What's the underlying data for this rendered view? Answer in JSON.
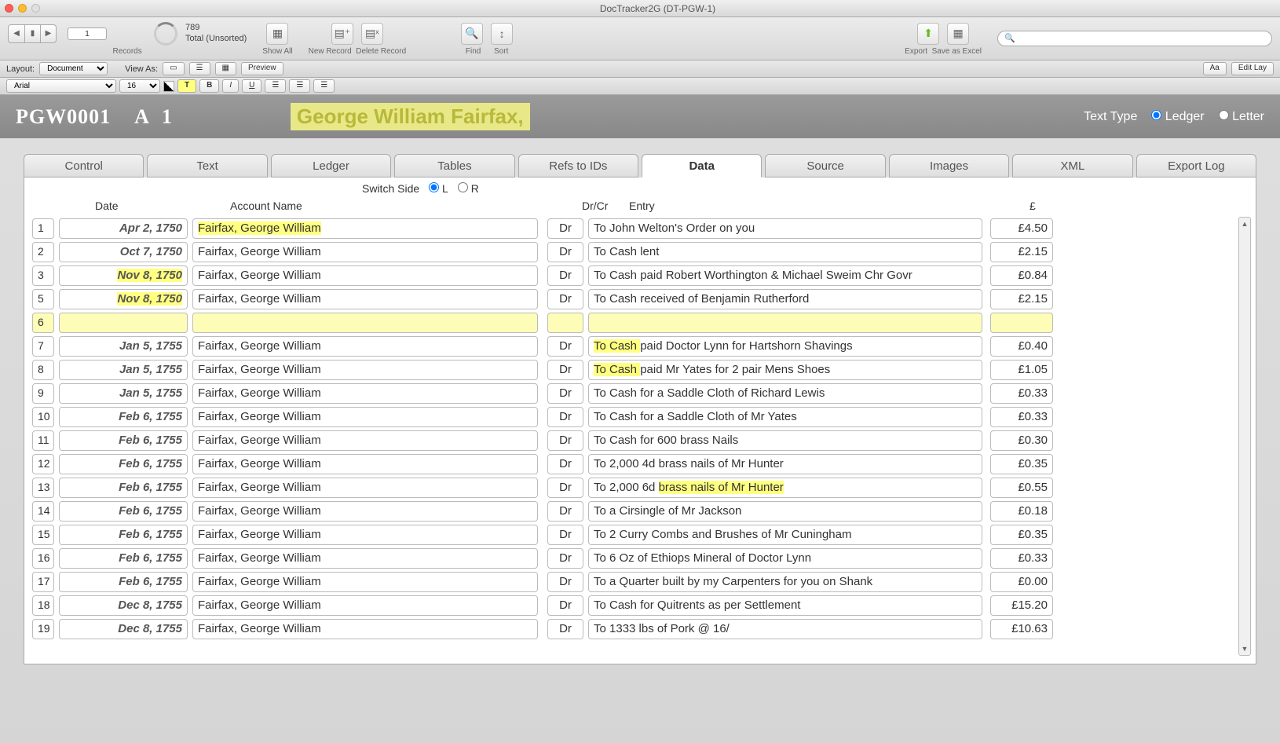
{
  "window_title": "DocTracker2G (DT-PGW-1)",
  "toolbar": {
    "record_number": "1",
    "total": "789",
    "sorted": "Total (Unsorted)",
    "records_label": "Records",
    "show_all": "Show All",
    "new_record": "New Record",
    "delete_record": "Delete Record",
    "find": "Find",
    "sort": "Sort",
    "export": "Export",
    "save_excel": "Save as Excel"
  },
  "layoutbar": {
    "layout_label": "Layout:",
    "layout_value": "Document",
    "viewas_label": "View As:",
    "preview": "Preview",
    "aa": "Aa",
    "editlay": "Edit Lay"
  },
  "formatbar": {
    "font": "Arial",
    "size": "16 pt"
  },
  "header": {
    "docid": "PGW0001",
    "side": "A",
    "page": "1",
    "person": "George William Fairfax,",
    "texttype": "Text Type",
    "ledger": "Ledger",
    "letter": "Letter"
  },
  "tabs": [
    "Control",
    "Text",
    "Ledger",
    "Tables",
    "Refs to IDs",
    "Data",
    "Source",
    "Images",
    "XML",
    "Export Log"
  ],
  "active_tab": "Data",
  "switch": {
    "label": "Switch Side",
    "L": "L",
    "R": "R"
  },
  "cols": {
    "date": "Date",
    "account": "Account Name",
    "drcr": "Dr/Cr",
    "entry": "Entry",
    "amt": "£"
  },
  "rows": [
    {
      "n": "1",
      "date": "Apr 2, 1750",
      "name": "Fairfax, George William",
      "drcr": "Dr",
      "entry": "To John Welton's Order on you",
      "amt": "£4.50",
      "name_hl": true
    },
    {
      "n": "2",
      "date": "Oct 7, 1750",
      "name": "Fairfax, George William",
      "drcr": "Dr",
      "entry": "To Cash lent",
      "amt": "£2.15"
    },
    {
      "n": "3",
      "date": "Nov 8, 1750",
      "name": "Fairfax, George William",
      "drcr": "Dr",
      "entry": "To Cash paid Robert Worthington & Michael Sweim Chr Govr",
      "amt": "£0.84",
      "date_hl": true
    },
    {
      "n": "5",
      "date": "Nov 8, 1750",
      "name": "Fairfax, George William",
      "drcr": "Dr",
      "entry": "To Cash received of Benjamin Rutherford",
      "amt": "£2.15",
      "date_hl": true
    },
    {
      "n": "6",
      "date": "",
      "name": "",
      "drcr": "",
      "entry": "",
      "amt": "",
      "selected": true
    },
    {
      "n": "7",
      "date": "Jan 5, 1755",
      "name": "Fairfax, George William",
      "drcr": "Dr",
      "entry_pre": "To Cash ",
      "entry_post": "paid Doctor Lynn for Hartshorn Shavings",
      "amt": "£0.40",
      "entry_hl": true
    },
    {
      "n": "8",
      "date": "Jan 5, 1755",
      "name": "Fairfax, George William",
      "drcr": "Dr",
      "entry_pre": "To Cash ",
      "entry_post": "paid Mr Yates for 2 pair Mens Shoes",
      "amt": "£1.05",
      "entry_hl": true
    },
    {
      "n": "9",
      "date": "Jan 5, 1755",
      "name": "Fairfax, George William",
      "drcr": "Dr",
      "entry": "To Cash for a Saddle Cloth of Richard Lewis",
      "amt": "£0.33"
    },
    {
      "n": "10",
      "date": "Feb 6, 1755",
      "name": "Fairfax, George William",
      "drcr": "Dr",
      "entry": "To Cash for a Saddle Cloth of Mr Yates",
      "amt": "£0.33"
    },
    {
      "n": "11",
      "date": "Feb 6, 1755",
      "name": "Fairfax, George William",
      "drcr": "Dr",
      "entry": "To Cash for 600 brass Nails",
      "amt": "£0.30"
    },
    {
      "n": "12",
      "date": "Feb 6, 1755",
      "name": "Fairfax, George William",
      "drcr": "Dr",
      "entry": "To 2,000 4d brass nails of Mr Hunter",
      "amt": "£0.35"
    },
    {
      "n": "13",
      "date": "Feb 6, 1755",
      "name": "Fairfax, George William",
      "drcr": "Dr",
      "entry_pre2": "To 2,000 6d ",
      "entry_hl2": "brass nails of Mr Hunter",
      "amt": "£0.55"
    },
    {
      "n": "14",
      "date": "Feb 6, 1755",
      "name": "Fairfax, George William",
      "drcr": "Dr",
      "entry": "To a Cirsingle of Mr Jackson",
      "amt": "£0.18"
    },
    {
      "n": "15",
      "date": "Feb 6, 1755",
      "name": "Fairfax, George William",
      "drcr": "Dr",
      "entry": "To 2 Curry Combs and Brushes of Mr Cuningham",
      "amt": "£0.35"
    },
    {
      "n": "16",
      "date": "Feb 6, 1755",
      "name": "Fairfax, George William",
      "drcr": "Dr",
      "entry": "To 6 Oz of Ethiops Mineral of Doctor Lynn",
      "amt": "£0.33"
    },
    {
      "n": "17",
      "date": "Feb 6, 1755",
      "name": "Fairfax, George William",
      "drcr": "Dr",
      "entry": "To a Quarter built by my Carpenters for you on Shank",
      "amt": "£0.00"
    },
    {
      "n": "18",
      "date": "Dec 8, 1755",
      "name": "Fairfax, George William",
      "drcr": "Dr",
      "entry": "To Cash for Quitrents as per Settlement",
      "amt": "£15.20"
    },
    {
      "n": "19",
      "date": "Dec 8, 1755",
      "name": "Fairfax, George William",
      "drcr": "Dr",
      "entry": "To 1333 lbs of Pork @ 16/",
      "amt": "£10.63"
    }
  ]
}
